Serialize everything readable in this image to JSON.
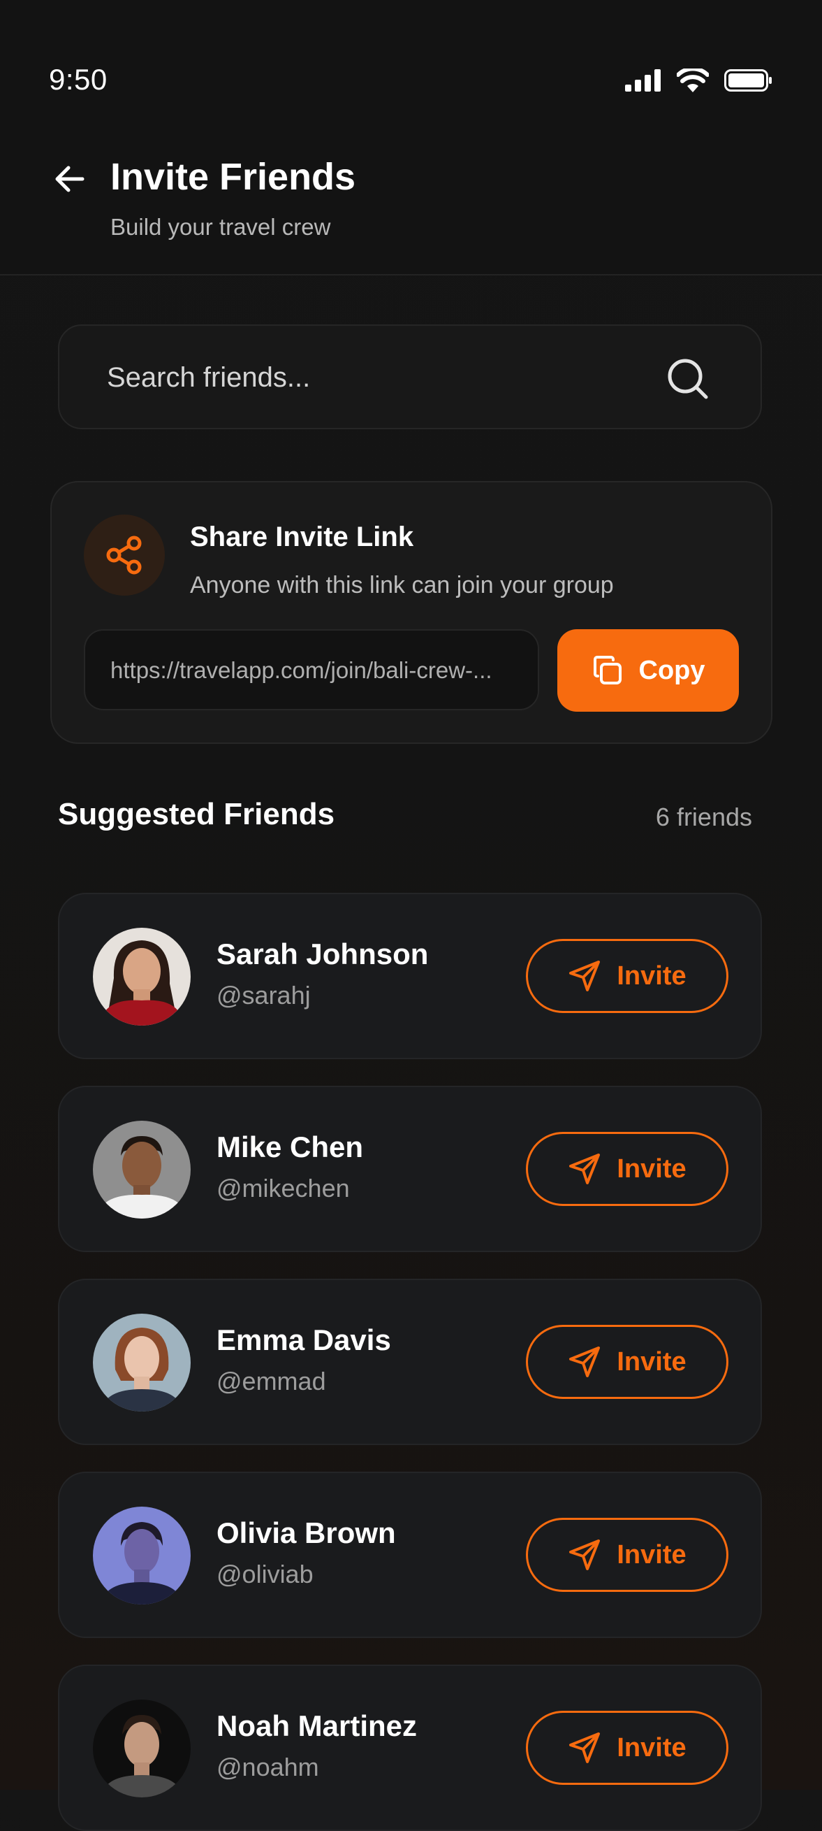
{
  "status_bar": {
    "time": "9:50"
  },
  "header": {
    "title": "Invite Friends",
    "subtitle": "Build your travel crew"
  },
  "search": {
    "placeholder": "Search friends..."
  },
  "share": {
    "title": "Share Invite Link",
    "description": "Anyone with this link can join your group",
    "link": "https://travelapp.com/join/bali-crew-...",
    "copy_label": "Copy"
  },
  "suggested": {
    "title": "Suggested Friends",
    "count": "6 friends",
    "friends": [
      {
        "name": "Sarah Johnson",
        "handle": "@sarahj",
        "invite_label": "Invite"
      },
      {
        "name": "Mike Chen",
        "handle": "@mikechen",
        "invite_label": "Invite"
      },
      {
        "name": "Emma Davis",
        "handle": "@emmad",
        "invite_label": "Invite"
      },
      {
        "name": "Olivia Brown",
        "handle": "@oliviab",
        "invite_label": "Invite"
      },
      {
        "name": "Noah Martinez",
        "handle": "@noahm",
        "invite_label": "Invite"
      }
    ]
  },
  "colors": {
    "accent": "#f76b0f",
    "background": "#141414",
    "card": "#1a1b1d"
  }
}
